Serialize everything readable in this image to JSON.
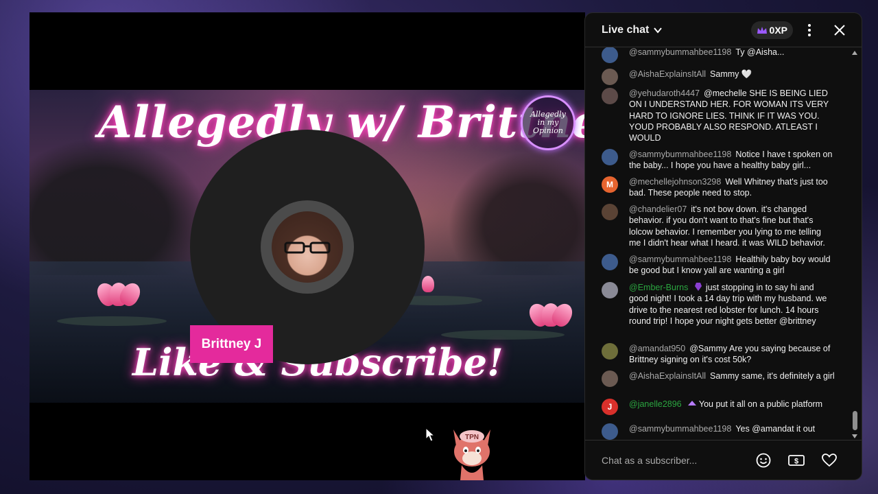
{
  "stream": {
    "banner_title": "Allegedly w/ Brittney J",
    "banner_footer": "Like & Subscribe!",
    "seal_text": "Allegedly in my Opinion",
    "name_tag": "Brittney J",
    "mascot_label": "TPN"
  },
  "chat": {
    "title": "Live chat",
    "xp": "0XP",
    "input_placeholder": "Chat as a subscriber...",
    "messages": [
      {
        "author": "@sammybummahbee1198",
        "text": "Ty @Aisha...",
        "avatar": "image"
      },
      {
        "author": "@AishaExplainsItAll",
        "text": "Sammy 🤍",
        "avatar": "image"
      },
      {
        "author": "@yehudaroth4447",
        "text": "@mechelle SHE IS BEING LIED ON I UNDERSTAND HER. FOR WOMAN ITS VERY HARD TO IGNORE LIES. THINK IF IT WAS YOU. YOUD PROBABLY ALSO RESPOND. ATLEAST I WOULD",
        "avatar": "image"
      },
      {
        "author": "@sammybummahbee1198",
        "text": "Notice I have t spoken on the baby... I hope you have a healthy baby girl...",
        "avatar": "image"
      },
      {
        "author": "@mechellejohnson3298",
        "text": "Well Whitney that's just too bad. These people need to stop.",
        "avatar": "M",
        "avatar_color": "#e6642f"
      },
      {
        "author": "@chandelier07",
        "text": "it's not bow down. it's changed behavior. if you don't want to that's fine but that's lolcow behavior. I remember you lying to me telling me I didn't hear what I heard. it was WILD behavior.",
        "avatar": "image"
      },
      {
        "author": "@sammybummahbee1198",
        "text": "Healthily baby boy would be good but I know yall are wanting a girl",
        "avatar": "image"
      },
      {
        "author": "@Ember-Burns",
        "text": "just stopping in to say hi and good night! I took a 14 day trip with my husband. we drive to the nearest red lobster for lunch. 14 hours round trip! I hope your night gets better @brittney",
        "avatar": "image",
        "member": true
      },
      {
        "author": "@amandat950",
        "text": "@Sammy Are you saying because of Brittney signing on it's cost 50k?",
        "avatar": "image"
      },
      {
        "author": "@AishaExplainsItAll",
        "text": "Sammy same, it's definitely a girl",
        "avatar": "image"
      },
      {
        "author": "@janelle2896",
        "text": "You put it all on a public platform",
        "avatar": "J",
        "avatar_color": "#d9302b",
        "member": true
      },
      {
        "author": "@sammybummahbee1198",
        "text": "Yes @amandat it out",
        "avatar": "image"
      }
    ]
  },
  "colors": {
    "accent_pink": "#e42a9c",
    "member_green": "#2ba640",
    "chat_bg": "#0f0f0f"
  }
}
